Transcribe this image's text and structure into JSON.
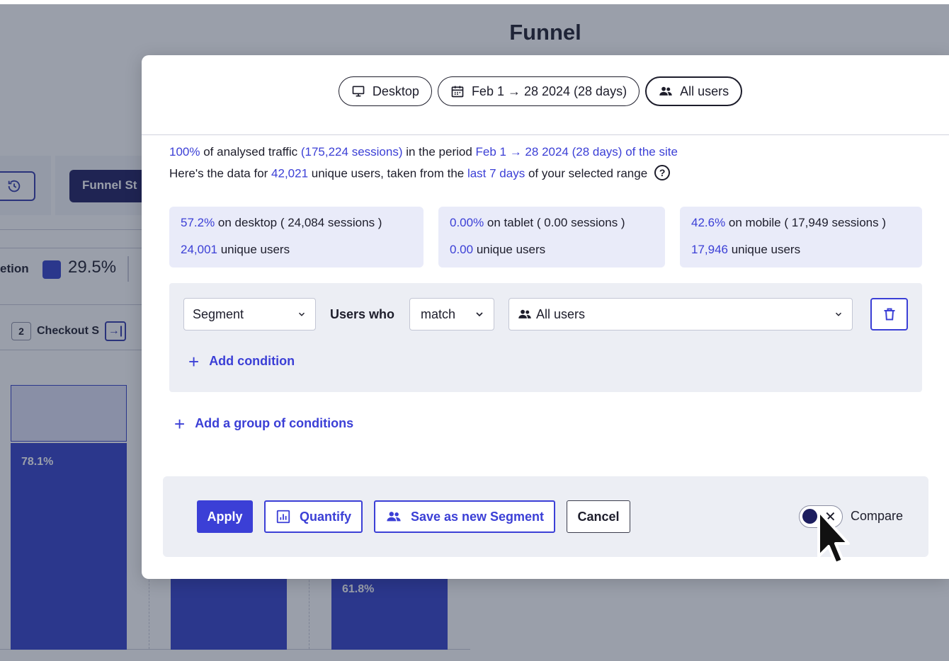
{
  "background": {
    "page_title": "Funnel",
    "funnel_button_label": "Funnel St",
    "legend_label": "etion",
    "legend_value": "29.5%",
    "step": {
      "number": "2",
      "label": "Checkout S"
    },
    "bars": [
      {
        "value_label": "78.1%",
        "fraction": 0.781
      },
      {
        "value_label": "",
        "fraction": 0.3
      },
      {
        "value_label": "61.8%",
        "fraction": 0.3
      }
    ],
    "colors": {
      "bar": "#3340c8",
      "dark_button": "#1c1d5e"
    }
  },
  "modal": {
    "pills": [
      {
        "label": "Desktop",
        "icon": "monitor-icon"
      },
      {
        "label": "Feb 1 → 28 2024 (28 days)",
        "icon": "calendar-icon"
      },
      {
        "label": "All users",
        "icon": "users-icon"
      }
    ],
    "info": {
      "line1_pct": "100%",
      "line1_a": " of analysed traffic ",
      "line1_sessions": "(175,224 sessions)",
      "line1_b": " in the period ",
      "line1_period": "Feb 1 → 28 2024 (28 days) of the site",
      "line2_a": "Here's the data for ",
      "line2_users": "42,021",
      "line2_b": " unique users, taken from the ",
      "line2_range": "last 7 days",
      "line2_c": " of your selected range",
      "help_symbol": "?"
    },
    "stats": [
      {
        "pct": "57.2%",
        "device_text": " on desktop ( 24,084 sessions )",
        "users": "24,001",
        "users_text": " unique users"
      },
      {
        "pct": "0.00%",
        "device_text": " on tablet ( 0.00 sessions )",
        "users": "0.00",
        "users_text": " unique users"
      },
      {
        "pct": "42.6%",
        "device_text": " on mobile ( 17,949 sessions )",
        "users": "17,946",
        "users_text": " unique users"
      }
    ],
    "condition": {
      "type_select": "Segment",
      "users_who": "Users who",
      "match_select": "match",
      "segment_select": "All users",
      "add_condition": "Add condition"
    },
    "add_group": "Add a group of conditions",
    "footer": {
      "apply": "Apply",
      "quantify": "Quantify",
      "save_segment": "Save as new Segment",
      "cancel": "Cancel",
      "compare": "Compare",
      "compare_on": false
    },
    "colors": {
      "accent": "#3b3fd6",
      "panel": "#eceef4",
      "stat_card": "#e9ebf9"
    }
  }
}
